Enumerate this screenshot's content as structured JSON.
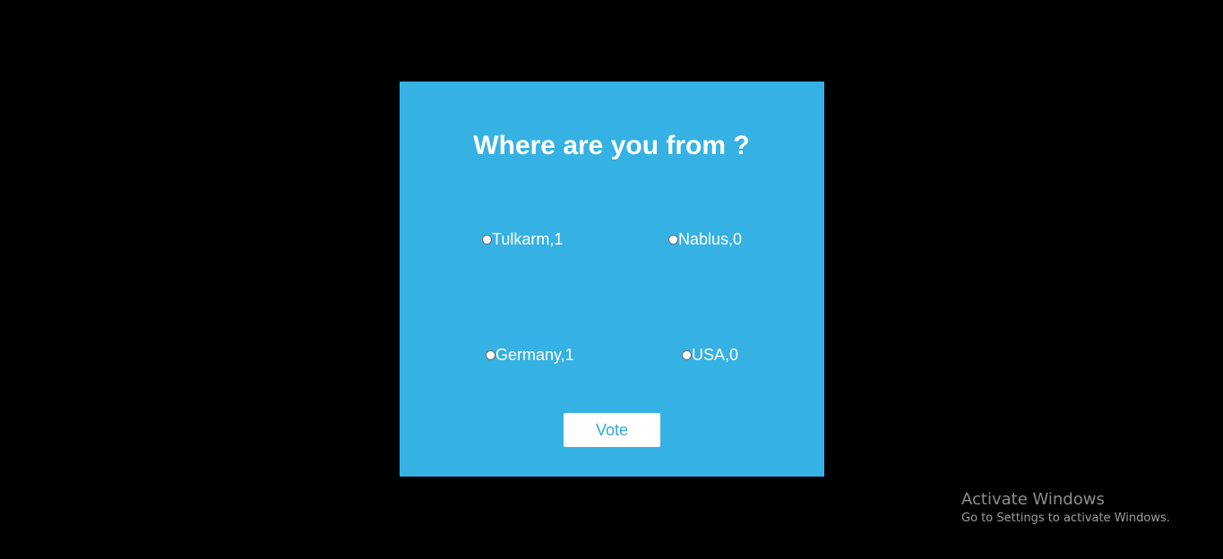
{
  "poll": {
    "title": "Where are you from ?",
    "options": [
      {
        "label": "Tulkarm,1",
        "selected": false
      },
      {
        "label": "Nablus,0",
        "selected": false
      },
      {
        "label": "Germany,1",
        "selected": false
      },
      {
        "label": "USA,0",
        "selected": false
      }
    ],
    "vote_label": "Vote"
  },
  "watermark": {
    "title": "Activate Windows",
    "subtitle": "Go to Settings to activate Windows."
  },
  "colors": {
    "background": "#000000",
    "card": "#35b1e3",
    "button_text": "#35a6d8"
  }
}
